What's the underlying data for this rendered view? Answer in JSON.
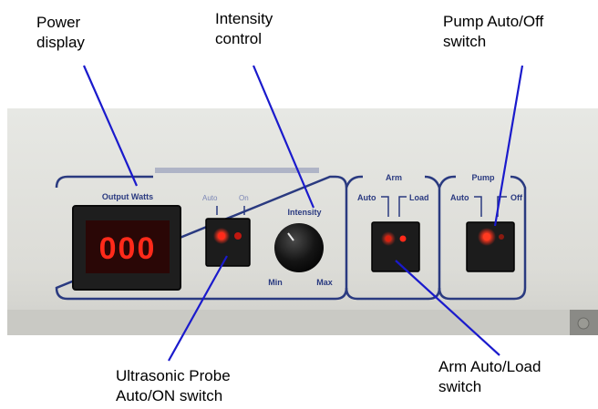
{
  "callouts": {
    "power_display": "Power\ndisplay",
    "intensity_control": "Intensity\ncontrol",
    "pump_switch": "Pump Auto/Off\nswitch",
    "probe_switch": "Ultrasonic Probe\nAuto/ON switch",
    "arm_switch": "Arm Auto/Load\nswitch"
  },
  "panel": {
    "output_watts": "Output Watts",
    "display_value": "000",
    "probe_auto_label": "Auto",
    "probe_on_label": "On",
    "intensity_label": "Intensity",
    "min_label": "Min",
    "max_label": "Max",
    "arm_title": "Arm",
    "arm_auto_label": "Auto",
    "arm_load_label": "Load",
    "pump_title": "Pump",
    "pump_auto_label": "Auto",
    "pump_off_label": "Off"
  },
  "colors": {
    "leader_line": "#1a1acc",
    "panel_outline": "#2a3a80",
    "led_red": "#ff2a1a",
    "display_digits": "#ff2a1a"
  }
}
